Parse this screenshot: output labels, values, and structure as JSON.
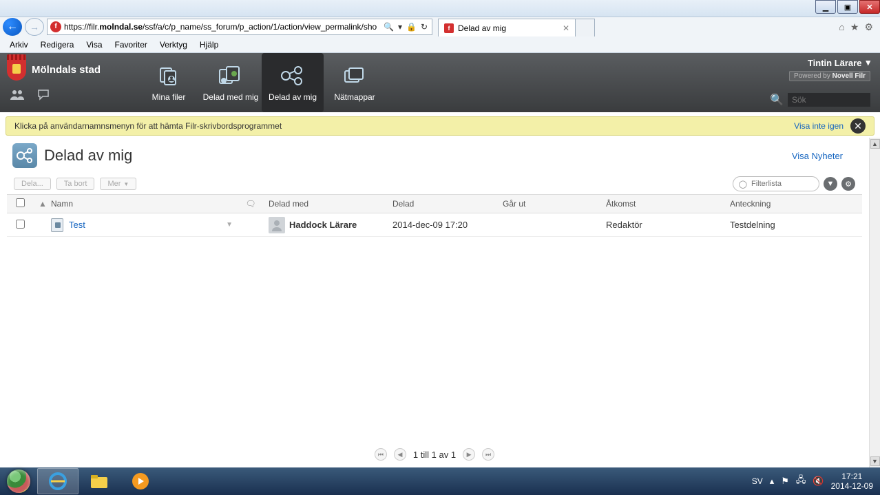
{
  "window": {
    "min": "▁",
    "max": "▣",
    "close": "✕"
  },
  "browser": {
    "url_prefix": "https://filr.",
    "url_domain": "molndal.se",
    "url_path": "/ssf/a/c/p_name/ss_forum/p_action/1/action/view_permalink/sho",
    "search_glyph": "🔍",
    "lock": "🔒",
    "refresh": "↻",
    "tab_title": "Delad av mig",
    "menu": [
      "Arkiv",
      "Redigera",
      "Visa",
      "Favoriter",
      "Verktyg",
      "Hjälp"
    ]
  },
  "brand": "Mölndals stad",
  "nav": {
    "items": [
      {
        "label": "Mina filer"
      },
      {
        "label": "Delad med mig"
      },
      {
        "label": "Delad av mig"
      },
      {
        "label": "Nätmappar"
      }
    ]
  },
  "user": {
    "name": "Tintin Lärare",
    "powered_prefix": "Powered by ",
    "powered_brand": "Novell Filr"
  },
  "search_placeholder": "Sök",
  "notice": {
    "text": "Klicka på användarnamnsmenyn för att hämta Filr-skrivbordsprogrammet",
    "dismiss": "Visa inte igen"
  },
  "page": {
    "title": "Delad av mig",
    "visa_nyheter": "Visa Nyheter"
  },
  "toolbar": {
    "dela": "Dela...",
    "tabort": "Ta bort",
    "mer": "Mer",
    "filter_placeholder": "Filterlista"
  },
  "cols": {
    "namn": "Namn",
    "delad_med": "Delad med",
    "delad": "Delad",
    "gar_ut": "Går ut",
    "atkomst": "Åtkomst",
    "anteckning": "Anteckning"
  },
  "rows": [
    {
      "name": "Test",
      "shared_with": "Haddock Lärare",
      "date": "2014-dec-09 17:20",
      "expires": "",
      "access": "Redaktör",
      "note": "Testdelning"
    }
  ],
  "pager": {
    "text": "1 till 1 av 1"
  },
  "tray": {
    "lang": "SV",
    "time": "17:21",
    "date": "2014-12-09"
  }
}
